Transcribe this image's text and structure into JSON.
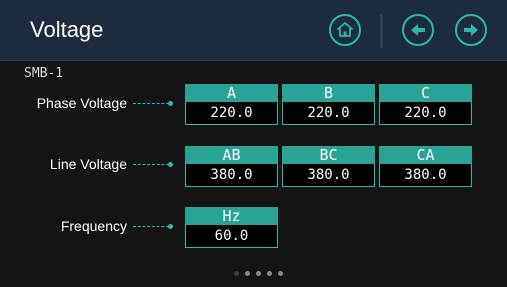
{
  "header": {
    "title": "Voltage",
    "buttons": [
      {
        "name": "home",
        "icon": "home-icon"
      },
      {
        "name": "back",
        "icon": "arrow-left-icon"
      },
      {
        "name": "forward",
        "icon": "arrow-right-icon"
      }
    ]
  },
  "device": "SMB-1",
  "rows": [
    {
      "label": "Phase Voltage",
      "cells": [
        {
          "head": "A",
          "value": "220.0"
        },
        {
          "head": "B",
          "value": "220.0"
        },
        {
          "head": "C",
          "value": "220.0"
        }
      ]
    },
    {
      "label": "Line Voltage",
      "cells": [
        {
          "head": "AB",
          "value": "380.0"
        },
        {
          "head": "BC",
          "value": "380.0"
        },
        {
          "head": "CA",
          "value": "380.0"
        }
      ]
    },
    {
      "label": "Frequency",
      "cells": [
        {
          "head": "Hz",
          "value": "60.0"
        }
      ]
    }
  ],
  "pager": {
    "pages": 5,
    "active": 0
  },
  "colors": {
    "accent": "#2bb9ad",
    "header_bg": "#1d2b3e",
    "cell_head": "#29a395"
  }
}
